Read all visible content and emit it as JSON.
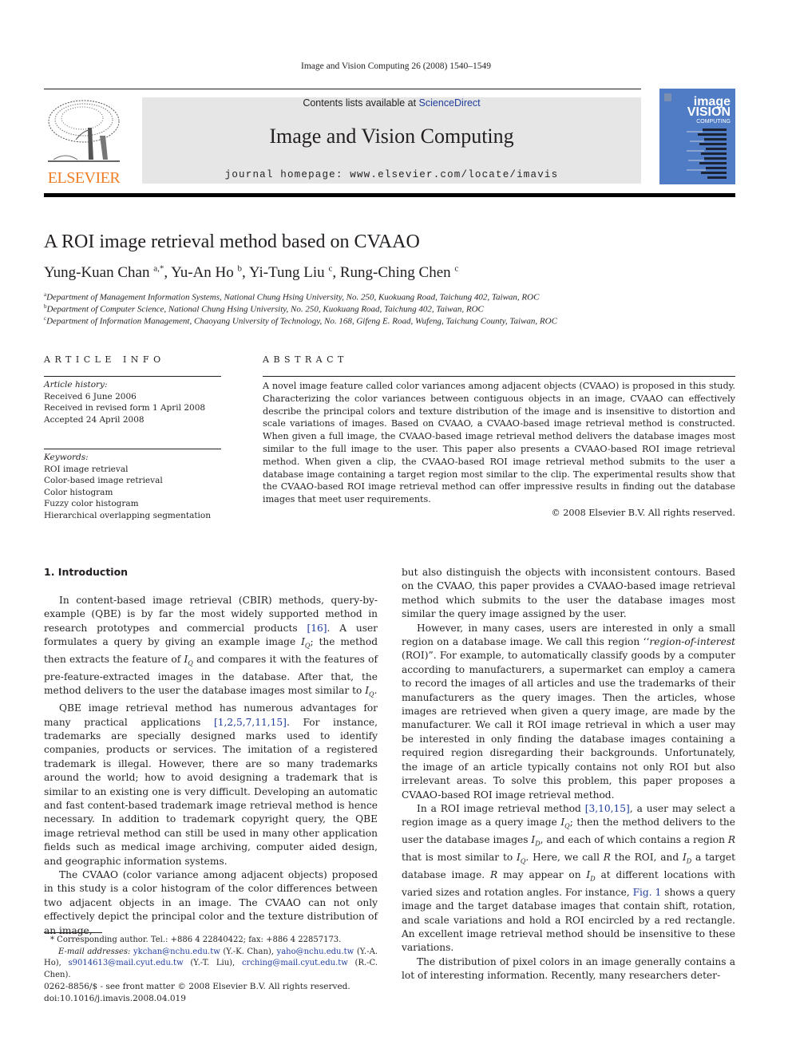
{
  "header": {
    "running_head": "Image and Vision Computing 26 (2008) 1540–1549",
    "contents_prefix": "Contents lists available at ",
    "contents_link": "ScienceDirect",
    "journal_title": "Image and Vision Computing",
    "homepage": "journal homepage: www.elsevier.com/locate/imavis",
    "publisher_logo_text": "ELSEVIER",
    "cover": {
      "line1": "image",
      "line2": "VISION",
      "line3": "COMPUTING",
      "background": "#4f7cc4"
    },
    "colors": {
      "publisher_orange": "#f07e26",
      "link_blue": "#1f3d9c",
      "banner_gray": "#e6e6e6"
    }
  },
  "article": {
    "title": "A ROI image retrieval method based on CVAAO",
    "authors": [
      {
        "name": "Yung-Kuan Chan",
        "sup": "a,*",
        "sep": ", "
      },
      {
        "name": "Yu-An Ho",
        "sup": "b",
        "sep": ", "
      },
      {
        "name": "Yi-Tung Liu",
        "sup": "c",
        "sep": ", "
      },
      {
        "name": "Rung-Ching Chen",
        "sup": "c",
        "sep": ""
      }
    ],
    "affiliations": [
      {
        "label": "a",
        "text": "Department of Management Information Systems, National Chung Hsing University, No. 250, Kuokuang Road, Taichung 402, Taiwan, ROC"
      },
      {
        "label": "b",
        "text": "Department of Computer Science, National Chung Hsing University, No. 250, Kuokuang Road, Taichung 402, Taiwan, ROC"
      },
      {
        "label": "c",
        "text": "Department of Information Management, Chaoyang University of Technology, No. 168, Gifeng E. Road, Wufeng, Taichung County, Taiwan, ROC"
      }
    ]
  },
  "article_info": {
    "heading": "ARTICLE INFO",
    "history_label": "Article history:",
    "history": [
      "Received 6 June 2006",
      "Received in revised form 1 April 2008",
      "Accepted 24 April 2008"
    ],
    "keywords_label": "Keywords:",
    "keywords": [
      "ROI image retrieval",
      "Color-based image retrieval",
      "Color histogram",
      "Fuzzy color histogram",
      "Hierarchical overlapping segmentation"
    ]
  },
  "abstract": {
    "heading": "ABSTRACT",
    "text": "A novel image feature called color variances among adjacent objects (CVAAO) is proposed in this study. Characterizing the color variances between contiguous objects in an image, CVAAO can effectively describe the principal colors and texture distribution of the image and is insensitive to distortion and scale variations of images. Based on CVAAO, a CVAAO-based image retrieval method is constructed. When given a full image, the CVAAO-based image retrieval method delivers the database images most similar to the full image to the user. This paper also presents a CVAAO-based ROI image retrieval method. When given a clip, the CVAAO-based ROI image retrieval method submits to the user a database image containing a target region most similar to the clip. The experimental results show that the CVAAO-based ROI image retrieval method can offer impressive results in finding out the database images that meet user requirements.",
    "copyright": "© 2008 Elsevier B.V. All rights reserved."
  },
  "body": {
    "section_heading": "1. Introduction",
    "left": {
      "p1_a": "In content-based image retrieval (CBIR) methods, query-by-example (QBE) is by far the most widely supported method in research prototypes and commercial products ",
      "p1_ref": "[16]",
      "p1_b": ". A user formulates a query by giving an example image ",
      "p1_c": "; the method then extracts the feature of ",
      "p1_d": " and compares it with the features of pre-feature-extracted images in the database. After that, the method delivers to the user the database images most similar to ",
      "p1_e": ".",
      "p2_a": "QBE image retrieval method has numerous advantages for many practical applications ",
      "p2_ref": "[1,2,5,7,11,15]",
      "p2_b": ". For instance, trademarks are specially designed marks used to identify companies, products or services. The imitation of a registered trademark is illegal. However, there are so many trademarks around the world; how to avoid designing a trademark that is similar to an existing one is very difficult. Developing an automatic and fast content-based trademark image retrieval method is hence necessary. In addition to trademark copyright query, the QBE image retrieval method can still be used in many other application fields such as medical image archiving, computer aided design, and geographic information systems.",
      "p3": "The CVAAO (color variance among adjacent objects) proposed in this study is a color histogram of the color differences between two adjacent objects in an image. The CVAAO can not only effectively depict the principal color and the texture distribution of an image,"
    },
    "right": {
      "p1": "but also distinguish the objects with inconsistent contours. Based on the CVAAO, this paper provides a CVAAO-based image retrieval method which submits to the user the database images most similar the query image assigned by the user.",
      "p2_a": "However, in many cases, users are interested in only a small region on a database image. We call this region ‘‘",
      "p2_em": "region-of-interest",
      "p2_b": " (ROI)”. For example, to automatically classify goods by a computer according to manufacturers, a supermarket can employ a camera to record the images of all articles and use the trademarks of their manufacturers as the query images. Then the articles, whose images are retrieved when given a query image, are made by the manufacturer. We call it ROI image retrieval in which a user may be interested in only finding the database images containing a required region disregarding their backgrounds. Unfortunately, the image of an article typically contains not only ROI but also irrelevant areas. To solve this problem, this paper proposes a CVAAO-based ROI image retrieval method.",
      "p3_a": "In a ROI image retrieval method ",
      "p3_ref": "[3,10,15]",
      "p3_b": ", a user may select a region image as a query image ",
      "p3_c": "; then the method delivers to the user the database images ",
      "p3_d": ", and each of which contains a region ",
      "p3_e": " that is most similar to ",
      "p3_f": ". Here, we call ",
      "p3_g": " the ROI, and ",
      "p3_h": " a target database image. ",
      "p3_i": " may appear on ",
      "p3_j": " at different locations with varied sizes and rotation angles. For instance, ",
      "p3_fig": "Fig. 1",
      "p3_k": " shows a query image and the target database images that contain shift, rotation, and scale variations and hold a ROI encircled by a red rectangle. An excellent image retrieval method should be insensitive to these variations.",
      "p4": "The distribution of pixel colors in an image generally contains a lot of interesting information. Recently, many researchers deter-",
      "sym_I": "I",
      "sym_Q": "Q",
      "sym_D": "D",
      "sym_R": "R"
    }
  },
  "footnote": {
    "star_line": "* Corresponding author. Tel.: +886 4 22840422; fax: +886 4 22857173.",
    "email_label": "E-mail addresses:",
    "emails": [
      {
        "addr": "ykchan@nchu.edu.tw",
        "who": " (Y.-K. Chan), "
      },
      {
        "addr": "yaho@nchu.edu.tw",
        "who": " (Y.-A. Ho), "
      },
      {
        "addr": "s9014613@mail.cyut.edu.tw",
        "who": " (Y.-T. Liu), "
      },
      {
        "addr": "crching@mail.cyut.edu.tw",
        "who": " (R.-C. Chen)."
      }
    ]
  },
  "front_matter": {
    "issn_line": "0262-8856/$ - see front matter © 2008 Elsevier B.V. All rights reserved.",
    "doi": "doi:10.1016/j.imavis.2008.04.019"
  }
}
